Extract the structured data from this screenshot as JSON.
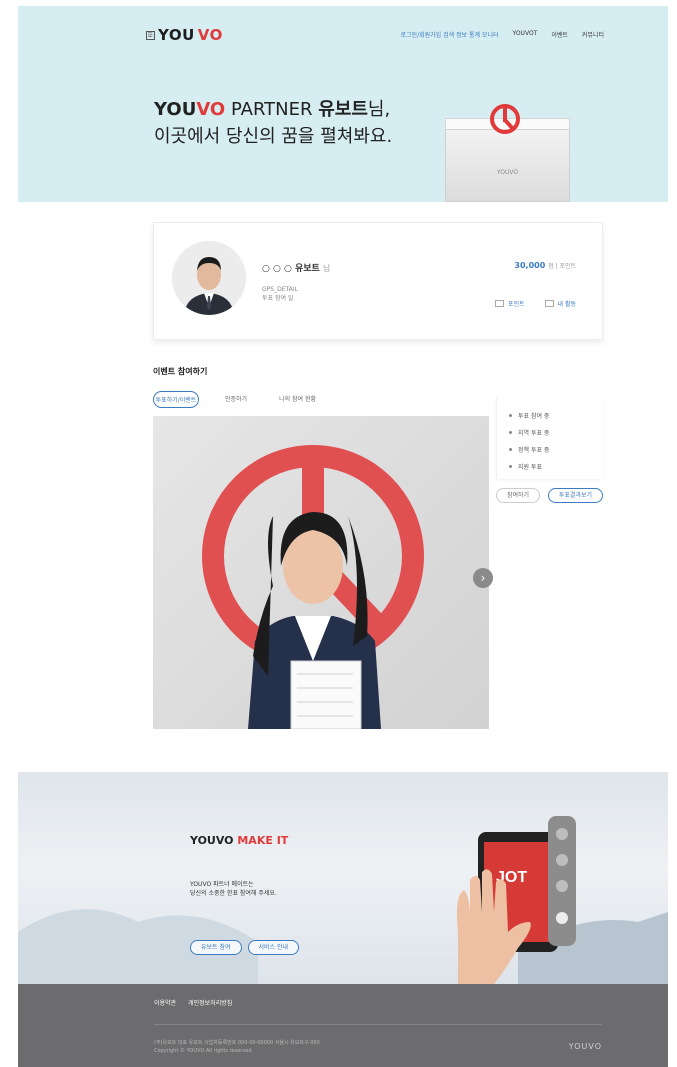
{
  "header": {
    "logo_prefix": "YOU",
    "logo_accent": "VO",
    "nav": [
      "로그인/회원가입 검색 정보 통계 모니터",
      "YOUVOT",
      "이벤트",
      "커뮤니티"
    ]
  },
  "hero": {
    "brand_prefix": "YOU",
    "brand_accent": "VO",
    "partner": " PARTNER ",
    "name_strong": "유보트",
    "name_suffix": "님,",
    "line2": "이곳에서 당신의 꿈을 펼쳐봐요.",
    "box_label": "YOUVO"
  },
  "profile": {
    "name": "○ ○ ○ 유보트",
    "verified": "님",
    "meta_line1": "GPS_DETAIL",
    "meta_line2": "투표 참여 일",
    "points_value": "30,000",
    "points_unit": "점 | 포인트",
    "action1": "포인트",
    "action2": "내 활동"
  },
  "section": {
    "title": "이벤트 참여하기",
    "tabs": [
      "투표하기/이벤트",
      "인증하기",
      "나의 참여 현황"
    ]
  },
  "side_list": [
    "투표 참여 중",
    "지역 투표 중",
    "정책 투표 중",
    "지원 투표"
  ],
  "side_buttons": {
    "left": "참여하기",
    "right": "투표결과보기"
  },
  "promo": {
    "title_prefix": "YOUVO",
    "title_accent": " MAKE IT",
    "desc_line1": "YOUVO 파트너 메이트는",
    "desc_line2": "당신의 소중한 한표 참여해 주세요.",
    "btn1": "유보트 참여",
    "btn2": "서비스 안내",
    "phone_text": "JOT"
  },
  "footer": {
    "links": [
      "이용약관",
      "개인정보처리방침"
    ],
    "copy_line1": "(주)유보트 대표 유보트 사업자등록번호 000-00-00000 서울시 유보트구 000",
    "copy_line2": "Copyright © YOUVO All rights reserved.",
    "logo": "YOUVO"
  },
  "colors": {
    "accent_red": "#e03a3a",
    "accent_blue": "#3b7bbf",
    "hero_bg": "#d6edf1",
    "footer_bg": "#6c6c6e"
  },
  "icons": [
    "ballot-mark-icon",
    "chevron-right-icon",
    "points-icon",
    "activity-icon"
  ]
}
